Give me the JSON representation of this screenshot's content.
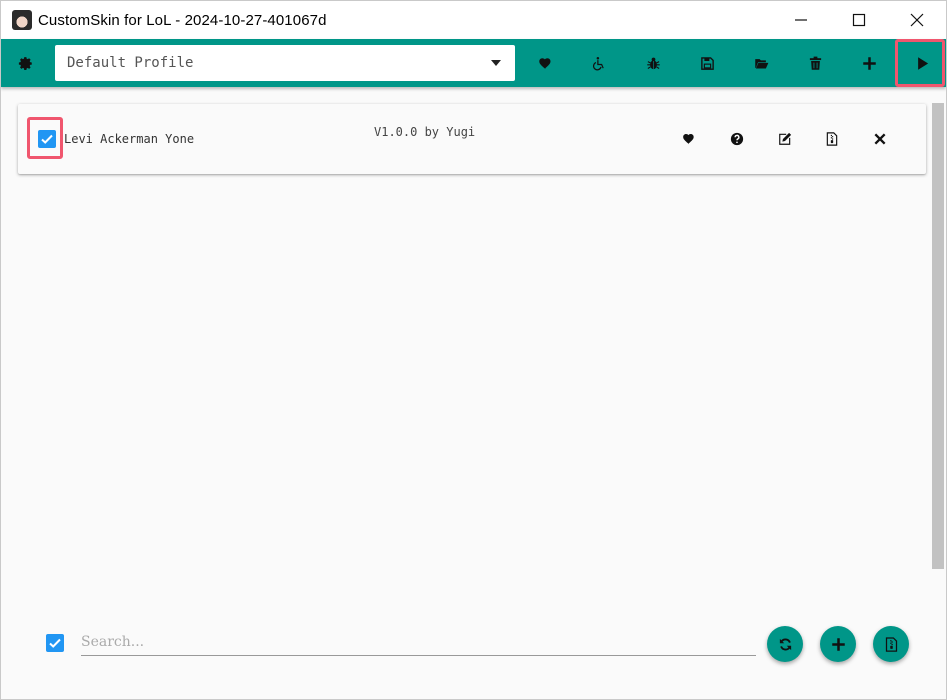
{
  "window": {
    "title": "CustomSkin for LoL - 2024-10-27-401067d"
  },
  "toolbar": {
    "profile": {
      "selected": "Default Profile"
    },
    "icons": [
      "gear-icon",
      "heart-icon",
      "wheelchair-icon",
      "bug-icon",
      "save-icon",
      "folder-open-icon",
      "trash-icon",
      "plus-icon",
      "play-icon"
    ]
  },
  "mods": [
    {
      "name": "Levi Ackerman Yone",
      "version_info": "V1.0.0 by Yugi",
      "enabled": true
    }
  ],
  "bottom": {
    "search_placeholder": "Search...",
    "select_all": true
  },
  "colors": {
    "accent": "#009688",
    "checkbox": "#2196f3",
    "highlight": "#f0566e"
  }
}
